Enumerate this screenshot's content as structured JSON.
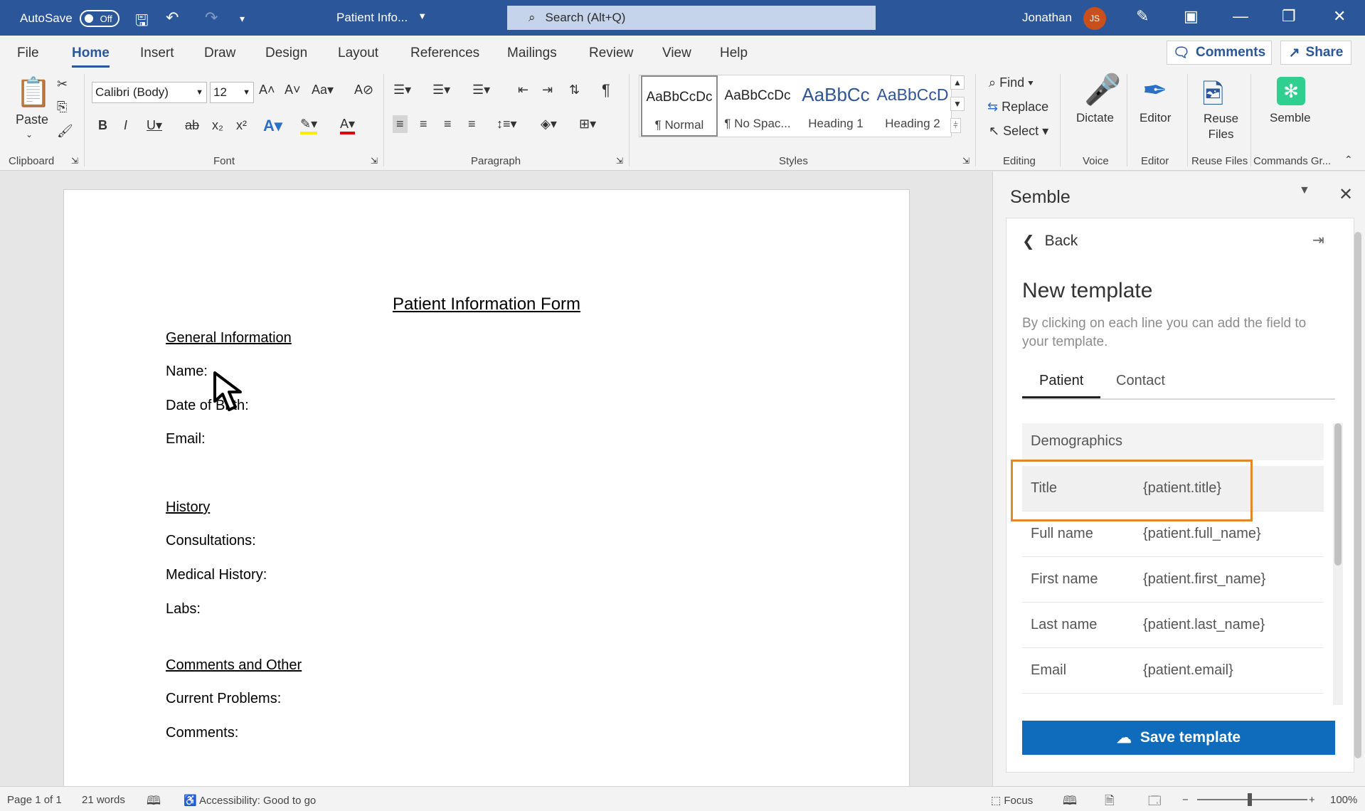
{
  "titlebar": {
    "autosave_label": "AutoSave",
    "autosave_state": "Off",
    "doc_name": "Patient Info...",
    "search_placeholder": "Search (Alt+Q)",
    "user_name": "Jonathan",
    "user_initials": "JS"
  },
  "menu_tabs": [
    "File",
    "Home",
    "Insert",
    "Draw",
    "Design",
    "Layout",
    "References",
    "Mailings",
    "Review",
    "View",
    "Help"
  ],
  "active_tab": "Home",
  "top_buttons": {
    "comments": "Comments",
    "share": "Share"
  },
  "ribbon": {
    "clipboard": {
      "paste": "Paste",
      "label": "Clipboard"
    },
    "font": {
      "family": "Calibri (Body)",
      "size": "12",
      "label": "Font"
    },
    "paragraph": {
      "label": "Paragraph"
    },
    "styles": {
      "label": "Styles",
      "items": [
        {
          "sample": "AaBbCcDc",
          "name": "¶ Normal"
        },
        {
          "sample": "AaBbCcDc",
          "name": "¶ No Spac..."
        },
        {
          "sample": "AaBbCc",
          "name": "Heading 1"
        },
        {
          "sample": "AaBbCcD",
          "name": "Heading 2"
        }
      ]
    },
    "editing": {
      "find": "Find",
      "replace": "Replace",
      "select": "Select",
      "label": "Editing"
    },
    "voice": {
      "dictate": "Dictate",
      "label": "Voice"
    },
    "editor": {
      "editor": "Editor",
      "label": "Editor"
    },
    "reuse": {
      "reuse_line1": "Reuse",
      "reuse_line2": "Files",
      "label": "Reuse Files"
    },
    "semble": {
      "semble": "Semble",
      "label": "Commands Gr..."
    }
  },
  "document": {
    "title": "Patient Information Form",
    "lines": [
      {
        "text": "General Information",
        "underline": true
      },
      {
        "text": "Name:",
        "underline": false
      },
      {
        "text": "Date of Birth:",
        "underline": false
      },
      {
        "text": "Email:",
        "underline": false
      },
      {
        "text": "History",
        "underline": true
      },
      {
        "text": "Consultations:",
        "underline": false
      },
      {
        "text": "Medical History:",
        "underline": false
      },
      {
        "text": "Labs:",
        "underline": false
      },
      {
        "text": "Comments and Other",
        "underline": true
      },
      {
        "text": "Current Problems:",
        "underline": false
      },
      {
        "text": "Comments:",
        "underline": false
      }
    ]
  },
  "pane": {
    "title": "Semble",
    "back": "Back",
    "heading": "New template",
    "description": "By clicking on each line you can add the field to your template.",
    "tabs": [
      "Patient",
      "Contact"
    ],
    "section": "Demographics",
    "fields": [
      {
        "label": "Title",
        "value": "{patient.title}"
      },
      {
        "label": "Full name",
        "value": "{patient.full_name}"
      },
      {
        "label": "First name",
        "value": "{patient.first_name}"
      },
      {
        "label": "Last name",
        "value": "{patient.last_name}"
      },
      {
        "label": "Email",
        "value": "{patient.email}"
      }
    ],
    "save_button": "Save template"
  },
  "statusbar": {
    "page": "Page 1 of 1",
    "words": "21 words",
    "accessibility": "Accessibility: Good to go",
    "focus": "Focus",
    "zoom": "100%"
  },
  "colors": {
    "accent": "#2b579a",
    "highlight": "#e0892a",
    "save": "#0f6cbd"
  }
}
